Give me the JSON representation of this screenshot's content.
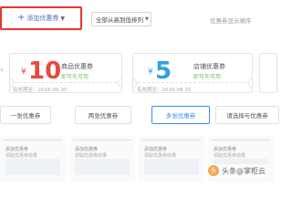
{
  "toolbar": {
    "add_coupon_label": "添加优惠券",
    "sort_label": "全部从高到低排列",
    "hint": "优惠券显示顺序"
  },
  "coupons": [
    {
      "currency": "¥",
      "amount": "10",
      "title": "商品优惠券",
      "status": "即可先可用",
      "valid": "有效期至：2016-06-30",
      "color": "#e64a3c"
    },
    {
      "currency": "¥",
      "amount": "5",
      "title": "店铺优惠券",
      "status": "即可先可用",
      "valid": "有效期至：2016-08-31",
      "color": "#2ea3e0"
    }
  ],
  "tabs": [
    {
      "label": "一张优惠券"
    },
    {
      "label": "两张优惠券"
    },
    {
      "label": "多张优惠券",
      "active": true
    },
    {
      "label": "请选择与优惠券"
    }
  ],
  "thumbnails": [
    {
      "title": "添加优惠券",
      "caption": "领取优惠券效果"
    },
    {
      "title": "添加优惠券",
      "caption": "领取优惠券效果"
    },
    {
      "title": "添加优惠券",
      "caption": "领取优惠券效果"
    },
    {
      "title": "添加优惠券",
      "caption": "领取优惠券效果"
    }
  ],
  "watermark": {
    "text": "头条@掌柜云",
    "logo_char": "头"
  },
  "colors": {
    "highlight_border": "#e8352e",
    "active_tab": "#3a8ee6",
    "status_green": "#7cc36a"
  },
  "icons": {
    "add": "plus-icon",
    "dropdown": "chevron-down-icon",
    "carousel_prev": "chevron-left-icon"
  }
}
